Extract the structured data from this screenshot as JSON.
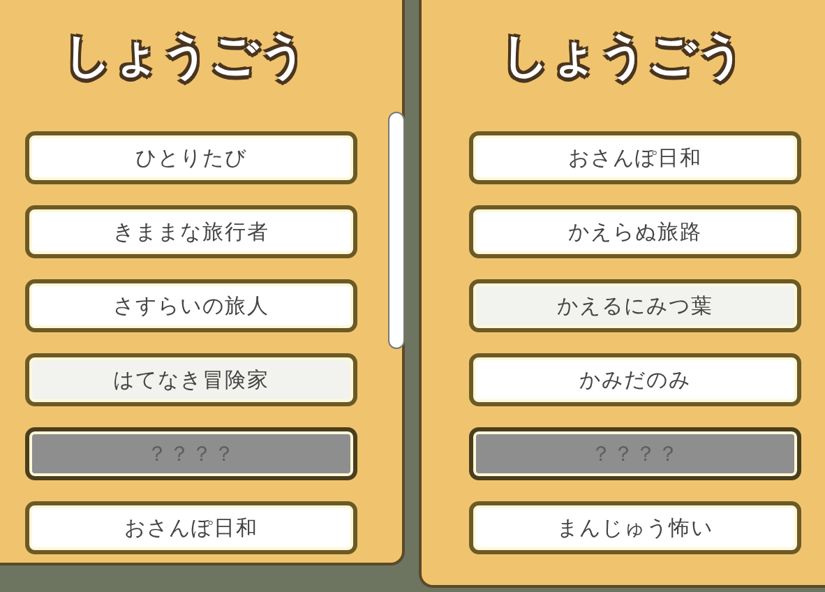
{
  "panels": [
    {
      "title": "しょうごう",
      "scrollbar": true,
      "items": [
        {
          "label": "ひとりたび",
          "locked": false,
          "dimmed": false
        },
        {
          "label": "きままな旅行者",
          "locked": false,
          "dimmed": false
        },
        {
          "label": "さすらいの旅人",
          "locked": false,
          "dimmed": false
        },
        {
          "label": "はてなき冒険家",
          "locked": false,
          "dimmed": true
        },
        {
          "label": "？？？？",
          "locked": true,
          "dimmed": false
        },
        {
          "label": "おさんぽ日和",
          "locked": false,
          "dimmed": false
        }
      ]
    },
    {
      "title": "しょうごう",
      "scrollbar": false,
      "items": [
        {
          "label": "おさんぽ日和",
          "locked": false,
          "dimmed": false
        },
        {
          "label": "かえらぬ旅路",
          "locked": false,
          "dimmed": false
        },
        {
          "label": "かえるにみつ葉",
          "locked": false,
          "dimmed": true
        },
        {
          "label": "かみだのみ",
          "locked": false,
          "dimmed": false
        },
        {
          "label": "？？？？",
          "locked": true,
          "dimmed": false
        },
        {
          "label": "まんじゅう怖い",
          "locked": false,
          "dimmed": false
        }
      ]
    }
  ]
}
